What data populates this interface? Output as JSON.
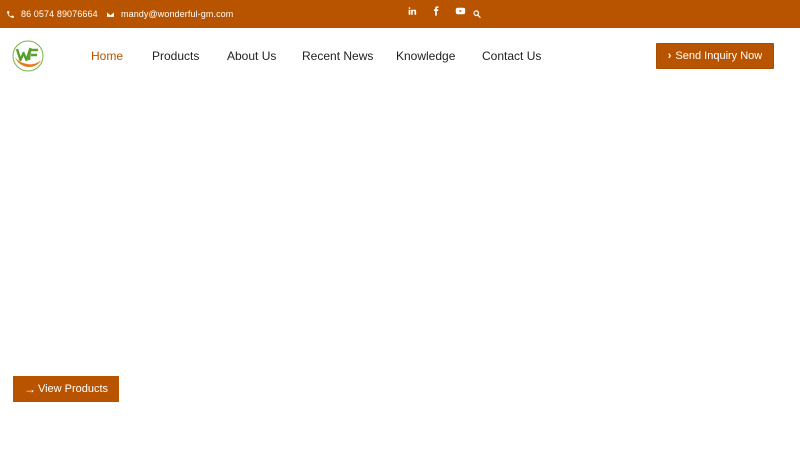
{
  "topbar": {
    "phone": "86 0574 89076664",
    "email": "mandy@wonderful-gm.com",
    "icons": [
      "phone-icon",
      "envelope-icon",
      "linkedin-icon",
      "facebook-icon",
      "youtube-icon",
      "search-icon"
    ],
    "background": "#b85400"
  },
  "header": {
    "nav": [
      {
        "label": "Home",
        "active": true
      },
      {
        "label": "Products",
        "active": false
      },
      {
        "label": "About Us",
        "active": false
      },
      {
        "label": "Recent News",
        "active": false
      },
      {
        "label": "Knowledge",
        "active": false
      },
      {
        "label": "Contact Us",
        "active": false
      }
    ],
    "cta_label": "Send Inquiry Now",
    "accent": "#b85400"
  },
  "hero": {
    "button_label": "View Products"
  }
}
